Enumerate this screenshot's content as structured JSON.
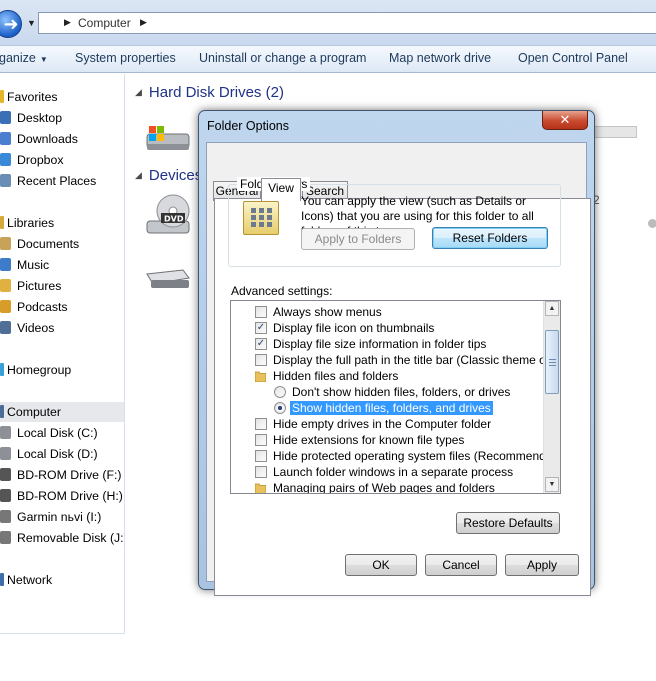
{
  "explorer": {
    "address": {
      "location": "Computer"
    },
    "toolbar": [
      "ganize",
      "System properties",
      "Uninstall or change a program",
      "Map network drive",
      "Open Control Panel"
    ],
    "nav": [
      {
        "label": "Favorites",
        "icon": "star-icon",
        "header": true
      },
      {
        "label": "Desktop",
        "icon": "desktop-icon"
      },
      {
        "label": "Downloads",
        "icon": "downloads-icon"
      },
      {
        "label": "Dropbox",
        "icon": "dropbox-icon"
      },
      {
        "label": "Recent Places",
        "icon": "recent-places-icon"
      },
      {
        "label": "Libraries",
        "icon": "libraries-icon",
        "header": true
      },
      {
        "label": "Documents",
        "icon": "documents-icon"
      },
      {
        "label": "Music",
        "icon": "music-icon"
      },
      {
        "label": "Pictures",
        "icon": "pictures-icon"
      },
      {
        "label": "Podcasts",
        "icon": "podcasts-icon"
      },
      {
        "label": "Videos",
        "icon": "videos-icon"
      },
      {
        "label": "Homegroup",
        "icon": "homegroup-icon",
        "header": true
      },
      {
        "label": "Computer",
        "icon": "computer-icon",
        "header": true,
        "selected": true
      },
      {
        "label": "Local Disk (C:)",
        "icon": "drive-icon"
      },
      {
        "label": "Local Disk (D:)",
        "icon": "drive-icon"
      },
      {
        "label": "BD-ROM Drive (F:) H",
        "icon": "bd-rom-icon"
      },
      {
        "label": "BD-ROM Drive (H:) F",
        "icon": "bd-rom-icon"
      },
      {
        "label": "Garmin nьvi (I:)",
        "icon": "removable-drive-icon"
      },
      {
        "label": "Removable Disk (J:)",
        "icon": "removable-drive-icon"
      },
      {
        "label": "Network",
        "icon": "network-icon",
        "header": true
      }
    ],
    "sections": [
      "Hard Disk Drives (2)",
      "Devices"
    ],
    "partial_texts": [
      "2"
    ],
    "dvd_label": "DVD"
  },
  "dialog": {
    "title": "Folder Options",
    "close_label": "✕",
    "tabs": [
      "General",
      "View",
      "Search"
    ],
    "active_tab": "View",
    "folder_views": {
      "label": "Folder views",
      "description": "You can apply the view (such as Details or Icons) that you are using for this folder to all folders of this type.",
      "apply_button": "Apply to Folders",
      "reset_button": "Reset Folders"
    },
    "advanced_label": "Advanced settings:",
    "settings": [
      {
        "type": "checkbox",
        "checked": false,
        "label": "Always show menus"
      },
      {
        "type": "checkbox",
        "checked": true,
        "label": "Display file icon on thumbnails"
      },
      {
        "type": "checkbox",
        "checked": true,
        "label": "Display file size information in folder tips"
      },
      {
        "type": "checkbox",
        "checked": false,
        "label": "Display the full path in the title bar (Classic theme only)"
      },
      {
        "type": "folder",
        "label": "Hidden files and folders"
      },
      {
        "type": "radio",
        "checked": false,
        "label": "Don't show hidden files, folders, or drives"
      },
      {
        "type": "radio",
        "checked": true,
        "selected": true,
        "label": "Show hidden files, folders, and drives"
      },
      {
        "type": "checkbox",
        "checked": false,
        "label": "Hide empty drives in the Computer folder"
      },
      {
        "type": "checkbox",
        "checked": false,
        "label": "Hide extensions for known file types"
      },
      {
        "type": "checkbox",
        "checked": false,
        "label": "Hide protected operating system files (Recommended)"
      },
      {
        "type": "checkbox",
        "checked": false,
        "label": "Launch folder windows in a separate process"
      },
      {
        "type": "folder",
        "label": "Managing pairs of Web pages and folders"
      }
    ],
    "restore_button": "Restore Defaults",
    "ok_button": "OK",
    "cancel_button": "Cancel",
    "apply_button": "Apply",
    "check_mark": "✓",
    "colors": {
      "selection": "#3399ff",
      "close": "#c94a2f",
      "frame": "#bfd6ee",
      "link": "#1e3287"
    }
  }
}
